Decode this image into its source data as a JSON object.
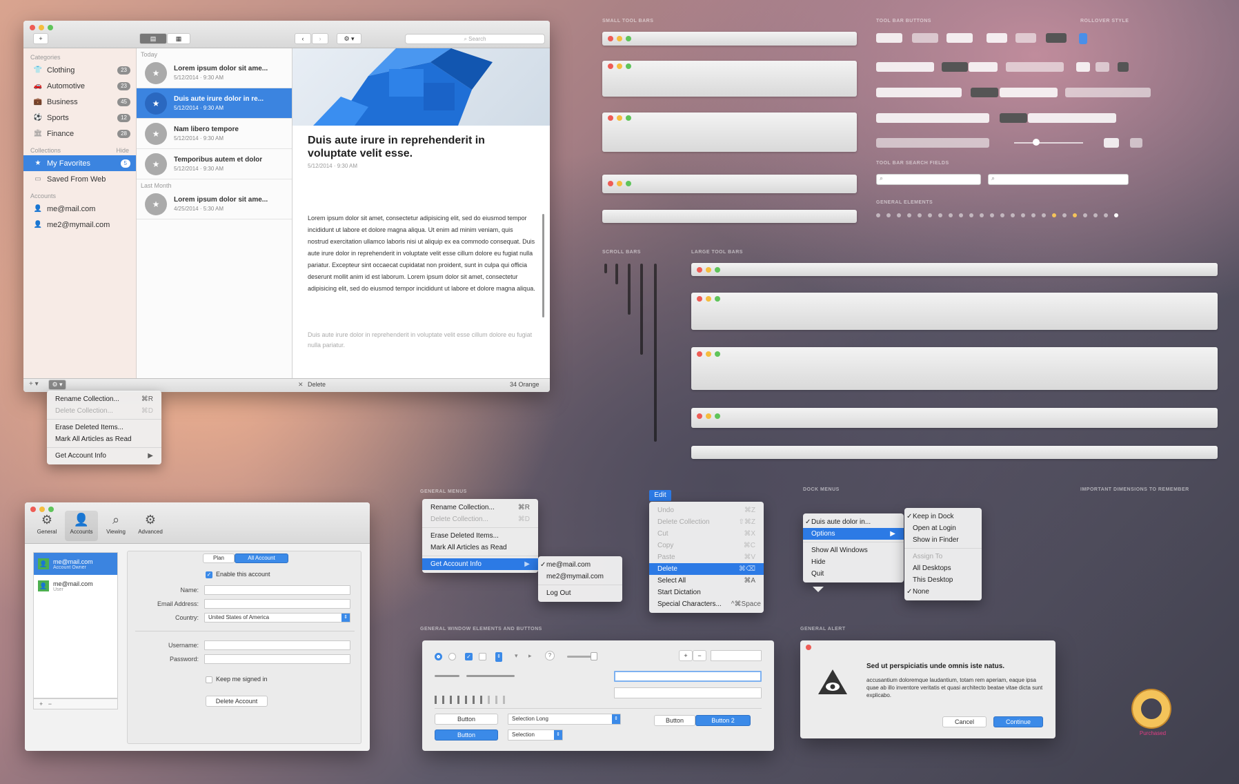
{
  "sections": {
    "small_tool_bars": "SMALL TOOL BARS",
    "tool_bar_buttons": "TOOL BAR BUTTONS",
    "rollover_style": "ROLLOVER STYLE",
    "tool_bar_search_fields": "TOOL BAR SEARCH FIELDS",
    "general_elements": "GENERAL ELEMENTS",
    "scroll_bars": "SCROLL BARS",
    "large_tool_bars": "LARGE TOOL BARS",
    "general_menus": "GENERAL MENUS",
    "dock_menus": "DOCK MENUS",
    "important_dimensions": "IMPORTANT DIMENSIONS TO REMEMBER",
    "general_window_elements": "GENERAL WINDOW ELEMENTS AND BUTTONS",
    "general_alert": "GENERAL ALERT"
  },
  "reader": {
    "search_placeholder": "Search",
    "categories_header": "Categories",
    "categories": [
      {
        "label": "Clothing",
        "count": "23",
        "icon": "shirt-icon"
      },
      {
        "label": "Automotive",
        "count": "23",
        "icon": "car-icon"
      },
      {
        "label": "Business",
        "count": "45",
        "icon": "briefcase-icon"
      },
      {
        "label": "Sports",
        "count": "12",
        "icon": "ball-icon"
      },
      {
        "label": "Finance",
        "count": "28",
        "icon": "finance-icon"
      }
    ],
    "collections_header": "Collections",
    "collections_action": "Hide",
    "collections": [
      {
        "label": "My Favorites",
        "count": "5"
      },
      {
        "label": "Saved From Web",
        "count": ""
      }
    ],
    "accounts_header": "Accounts",
    "accounts": [
      "me@mail.com",
      "me2@mymail.com"
    ],
    "list_today": "Today",
    "list_last_month": "Last Month",
    "articles": [
      {
        "title": "Lorem ipsum dolor sit ame...",
        "date": "5/12/2014 · 9:30 AM"
      },
      {
        "title": "Duis aute irure dolor in re...",
        "date": "5/12/2014 · 9:30 AM"
      },
      {
        "title": "Nam libero tempore",
        "date": "5/12/2014 · 9:30 AM"
      },
      {
        "title": "Temporibus autem et dolor",
        "date": "5/12/2014 · 9:30 AM"
      },
      {
        "title": "Lorem ipsum dolor sit ame...",
        "date": "4/25/2014 · 5:30 AM"
      }
    ],
    "article_title": "Duis aute irure in reprehenderit in voluptate velit esse.",
    "article_date": "5/12/2014 · 9:30 AM",
    "article_body": "Lorem ipsum dolor sit amet, consectetur adipisicing elit, sed do eiusmod tempor incididunt ut labore et dolore magna aliqua. Ut enim ad minim veniam, quis nostrud exercitation ullamco laboris nisi ut aliquip ex ea commodo consequat. Duis aute irure dolor in reprehenderit in voluptate velit esse cillum dolore eu fugiat nulla pariatur. Excepteur sint occaecat cupidatat non proident, sunt in culpa qui officia deserunt mollit anim id est laborum. Lorem ipsum dolor sit amet, consectetur adipisicing elit, sed do eiusmod tempor incididunt ut labore et dolore magna aliqua.",
    "article_body_faded": "Duis aute irure dolor in reprehenderit in voluptate velit esse cillum dolore eu fugiat nulla pariatur.",
    "delete_label": "Delete",
    "footer_status": "34 Orange"
  },
  "collection_menu": [
    {
      "label": "Rename Collection...",
      "shortcut": "⌘R",
      "disabled": false
    },
    {
      "label": "Delete Collection...",
      "shortcut": "⌘D",
      "disabled": true
    },
    {
      "label": "Erase Deleted Items...",
      "shortcut": "",
      "disabled": false
    },
    {
      "label": "Mark All Articles as Read",
      "shortcut": "",
      "disabled": false
    },
    {
      "label": "Get Account Info",
      "shortcut": "▶",
      "disabled": false
    }
  ],
  "prefs": {
    "tabs": [
      {
        "label": "General",
        "icon": "gear-icon"
      },
      {
        "label": "Accounts",
        "icon": "person-icon"
      },
      {
        "label": "Viewing",
        "icon": "magnifier-icon"
      },
      {
        "label": "Advanced",
        "icon": "cog-icon"
      }
    ],
    "accounts": [
      {
        "name": "me@mail.com",
        "sub": "Account Owner"
      },
      {
        "name": "me@mail.com",
        "sub": "User"
      }
    ],
    "seg_plan": "Plan",
    "seg_all_account": "All Account",
    "enable_label": "Enable this account",
    "name_label": "Name:",
    "email_label": "Email Address:",
    "country_label": "Country:",
    "country_value": "United States of America",
    "username_label": "Username:",
    "password_label": "Password:",
    "keep_signed_label": "Keep me signed in",
    "delete_account": "Delete Account"
  },
  "general_menu": [
    {
      "label": "Rename Collection...",
      "shortcut": "⌘R",
      "disabled": false
    },
    {
      "label": "Delete Collection...",
      "shortcut": "⌘D",
      "disabled": true
    },
    {
      "label": "Erase Deleted Items...",
      "shortcut": "",
      "disabled": false
    },
    {
      "label": "Mark All Articles as Read",
      "shortcut": "",
      "disabled": false
    },
    {
      "label": "Get Account Info",
      "shortcut": "▶",
      "disabled": false
    }
  ],
  "account_submenu": [
    "me@mail.com",
    "me2@mymail.com",
    "Log Out"
  ],
  "edit_menu": {
    "title": "Edit",
    "items": [
      {
        "label": "Undo",
        "shortcut": "⌘Z",
        "disabled": true
      },
      {
        "label": "Delete Collection",
        "shortcut": "⇧⌘Z",
        "disabled": true
      },
      {
        "label": "Cut",
        "shortcut": "⌘X",
        "disabled": true
      },
      {
        "label": "Copy",
        "shortcut": "⌘C",
        "disabled": true
      },
      {
        "label": "Paste",
        "shortcut": "⌘V",
        "disabled": true
      },
      {
        "label": "Delete",
        "shortcut": "⌘⌫",
        "disabled": false
      },
      {
        "label": "Select All",
        "shortcut": "⌘A",
        "disabled": false
      },
      {
        "label": "Start Dictation",
        "shortcut": "",
        "disabled": false
      },
      {
        "label": "Special Characters...",
        "shortcut": "^⌘Space",
        "disabled": false
      }
    ]
  },
  "dock_menu": {
    "items": [
      "Duis aute dolor in...",
      "Options",
      "Show All Windows",
      "Hide",
      "Quit"
    ],
    "sub": [
      "Keep in Dock",
      "Open at Login",
      "Show in Finder",
      "Assign To",
      "All Desktops",
      "This Desktop",
      "None"
    ]
  },
  "window_elements": {
    "button": "Button",
    "selection_long": "Selection Long",
    "selection": "Selection",
    "button_b": "Button",
    "button_c": "Button",
    "button_d": "Button 2"
  },
  "alert": {
    "title": "Sed ut perspiciatis unde omnis iste natus.",
    "body": "accusantium doloremque laudantium, totam rem aperiam, eaque ipsa quae ab illo inventore veritatis et quasi architecto beatae vitae dicta sunt explicabo.",
    "cancel": "Cancel",
    "continue": "Continue"
  },
  "logo_caption": "Purchased"
}
